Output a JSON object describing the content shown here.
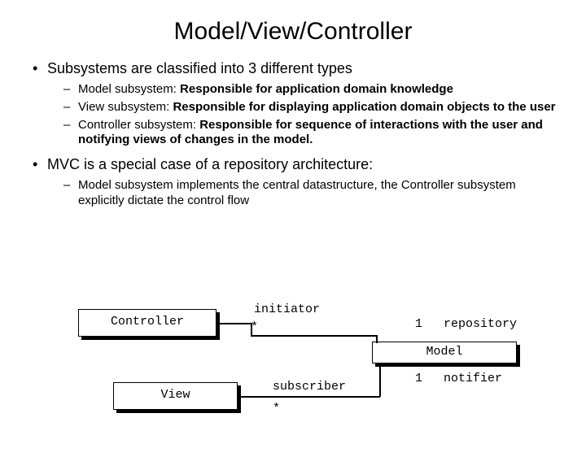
{
  "title": "Model/View/Controller",
  "bullets": {
    "b1": "Subsystems are classified into 3 different types",
    "b1_1_prefix": "Model subsystem: ",
    "b1_1_bold": "Responsible for application domain knowledge",
    "b1_2_prefix": "View subsystem: ",
    "b1_2_bold": "Responsible for displaying application domain objects to the user",
    "b1_3_prefix": "Controller subsystem:  ",
    "b1_3_bold": "Responsible for sequence of interactions with the user and notifying views of changes in the model.",
    "b2": "MVC is a special case of a repository architecture:",
    "b2_1": "Model subsystem implements the central datastructure, the Controller subsystem explicitly dictate the control flow"
  },
  "diagram": {
    "controller": "Controller",
    "view": "View",
    "model": "Model",
    "initiator": "initiator",
    "subscriber": "subscriber",
    "repository": "repository",
    "notifier": "notifier",
    "star1": "*",
    "one1": "1",
    "star2": "*",
    "one2": "1"
  }
}
